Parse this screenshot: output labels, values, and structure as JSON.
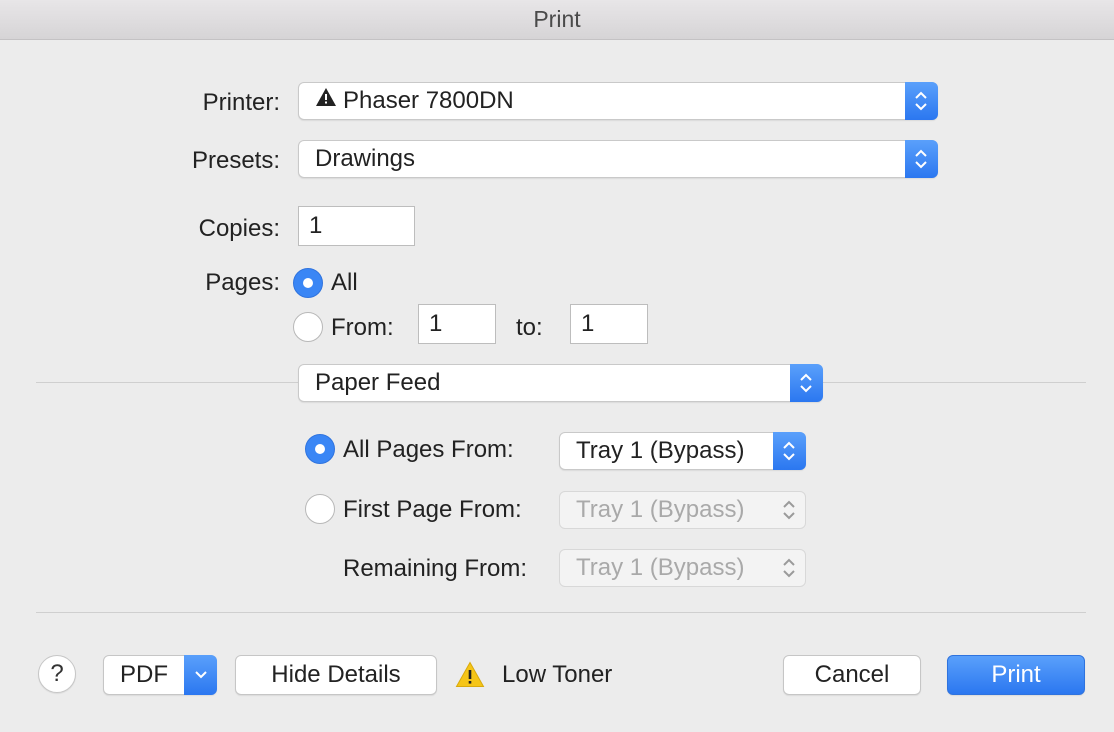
{
  "window": {
    "title": "Print"
  },
  "printer": {
    "label": "Printer:",
    "value": "Phaser 7800DN",
    "status_icon": "warning-triangle-icon"
  },
  "presets": {
    "label": "Presets:",
    "value": "Drawings"
  },
  "copies": {
    "label": "Copies:",
    "value": "1"
  },
  "pages": {
    "label": "Pages:",
    "all_label": "All",
    "all_selected": true,
    "from_label": "From:",
    "from_value": "1",
    "to_label": "to:",
    "to_value": "1"
  },
  "section": {
    "value": "Paper Feed"
  },
  "paper_feed": {
    "all_pages_label": "All Pages From:",
    "all_pages_value": "Tray 1 (Bypass)",
    "first_page_label": "First Page From:",
    "first_page_value": "Tray 1 (Bypass)",
    "remaining_label": "Remaining From:",
    "remaining_value": "Tray 1 (Bypass)"
  },
  "footer": {
    "help_label": "?",
    "pdf_label": "PDF",
    "hide_details_label": "Hide Details",
    "status_text": "Low Toner",
    "cancel_label": "Cancel",
    "print_label": "Print"
  },
  "colors": {
    "accent": "#2b77f0",
    "warning": "#f5c518"
  }
}
